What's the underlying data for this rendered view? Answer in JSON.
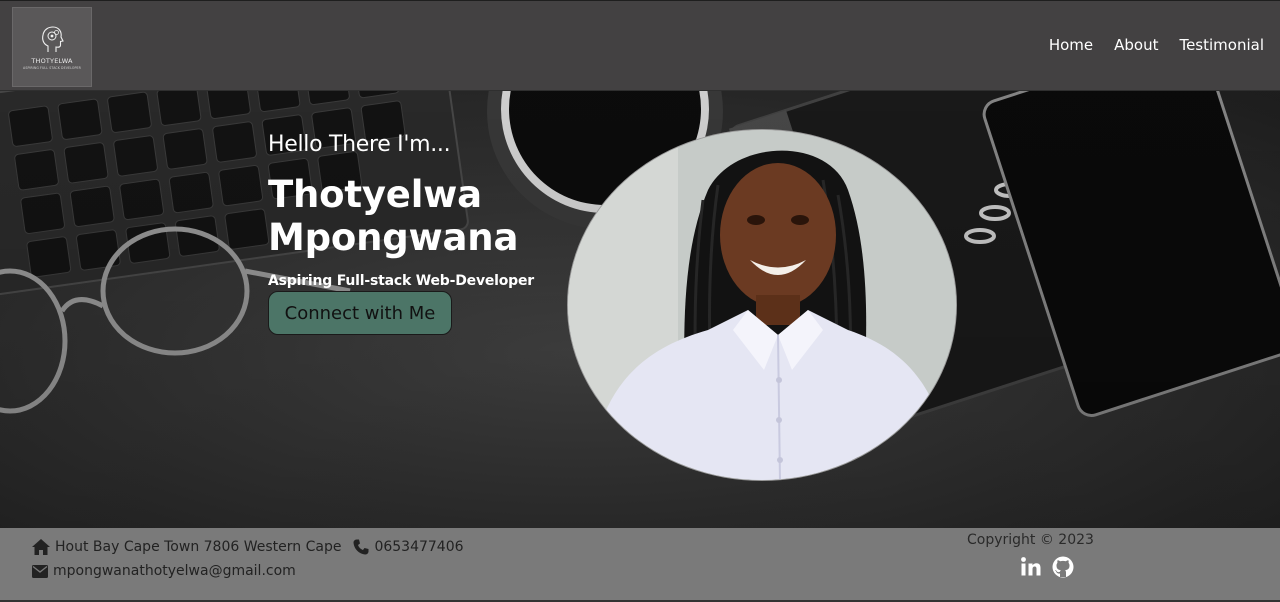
{
  "logo": {
    "title": "THOTYELWA",
    "subtitle": "ASPIRING FULL STACK DEVELOPER"
  },
  "nav": {
    "items": [
      {
        "label": "Home"
      },
      {
        "label": "About"
      },
      {
        "label": "Testimonial"
      }
    ]
  },
  "hero": {
    "greeting": "Hello There I'm...",
    "name": "Thotyelwa Mpongwana",
    "tagline": "Aspiring Full-stack Web-Developer",
    "cta_label": "Connect with Me"
  },
  "footer": {
    "address": "Hout Bay Cape Town 7806 Western Cape",
    "phone": "0653477406",
    "email": "mpongwanathotyelwa@gmail.com",
    "copyright": "Copyright © 2023",
    "social": [
      {
        "icon": "linkedin-icon"
      },
      {
        "icon": "github-icon"
      }
    ]
  },
  "colors": {
    "navbar": "#434142",
    "button": "#4c7567",
    "footer": "#7a7a7a"
  }
}
